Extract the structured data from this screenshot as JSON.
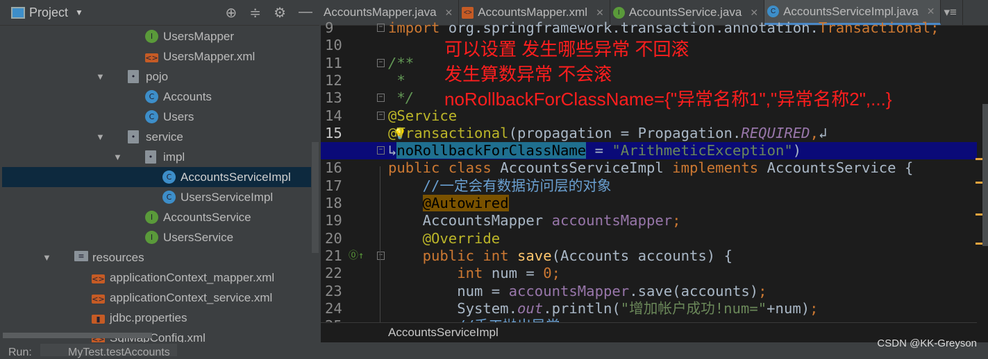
{
  "sidebar": {
    "title": "Project",
    "tree": [
      {
        "label": "UsersMapper",
        "icon": "interface",
        "depth": 4
      },
      {
        "label": "UsersMapper.xml",
        "icon": "xml",
        "depth": 4
      },
      {
        "label": "pojo",
        "icon": "package",
        "depth": 3,
        "expanded": true
      },
      {
        "label": "Accounts",
        "icon": "class",
        "depth": 4
      },
      {
        "label": "Users",
        "icon": "class",
        "depth": 4
      },
      {
        "label": "service",
        "icon": "package",
        "depth": 3,
        "expanded": true
      },
      {
        "label": "impl",
        "icon": "package",
        "depth": 4,
        "expanded": true
      },
      {
        "label": "AccountsServiceImpl",
        "icon": "class",
        "depth": 5,
        "selected": true
      },
      {
        "label": "UsersServiceImpl",
        "icon": "class",
        "depth": 5
      },
      {
        "label": "AccountsService",
        "icon": "interface",
        "depth": 4
      },
      {
        "label": "UsersService",
        "icon": "interface",
        "depth": 4
      },
      {
        "label": "resources",
        "icon": "resources-folder",
        "depth": 1,
        "expanded": true
      },
      {
        "label": "applicationContext_mapper.xml",
        "icon": "spring-xml",
        "depth": 2
      },
      {
        "label": "applicationContext_service.xml",
        "icon": "spring-xml",
        "depth": 2
      },
      {
        "label": "jdbc.properties",
        "icon": "properties",
        "depth": 2
      },
      {
        "label": "SqlMapConfig.xml",
        "icon": "xml",
        "depth": 2
      }
    ]
  },
  "tabs": [
    {
      "label": "AccountsMapper.java",
      "icon": "",
      "active": false
    },
    {
      "label": "AccountsMapper.xml",
      "icon": "xml",
      "active": false
    },
    {
      "label": "AccountsService.java",
      "icon": "interface",
      "active": false
    },
    {
      "label": "AccountsServiceImpl.java",
      "icon": "class",
      "active": true
    }
  ],
  "code": [
    {
      "n": "9",
      "t": [
        [
          "kw",
          "import "
        ],
        [
          "df",
          "org.springframework.transaction.annotation."
        ],
        [
          "kw",
          "Transactional;"
        ]
      ]
    },
    {
      "n": "10",
      "t": []
    },
    {
      "n": "11",
      "t": [
        [
          "cm",
          "/**"
        ]
      ]
    },
    {
      "n": "12",
      "t": [
        [
          "cm",
          " *"
        ]
      ]
    },
    {
      "n": "13",
      "t": [
        [
          "cm",
          " */"
        ]
      ]
    },
    {
      "n": "14",
      "t": [
        [
          "an",
          "@Service"
        ]
      ]
    },
    {
      "n": "15",
      "cur": true,
      "t": [
        [
          "an",
          "@Transactional"
        ],
        [
          "df",
          "(propagation = Propagation."
        ],
        [
          "it",
          "REQUIRED"
        ],
        [
          "kw",
          ","
        ],
        [
          "df",
          "↲"
        ]
      ]
    },
    {
      "n": "",
      "hl": true,
      "t": [
        [
          "df",
          "↳"
        ],
        [
          "sel",
          "noRollbackForClassName"
        ],
        [
          "df",
          " = "
        ],
        [
          "st",
          "\"ArithmeticException\""
        ],
        [
          "df",
          ")"
        ]
      ]
    },
    {
      "n": "16",
      "t": [
        [
          "kw",
          "public class "
        ],
        [
          "df",
          "AccountsServiceImpl "
        ],
        [
          "kw",
          "implements "
        ],
        [
          "df",
          "AccountsService {"
        ]
      ]
    },
    {
      "n": "17",
      "t": [
        [
          "df",
          "    "
        ],
        [
          "lc",
          "//一定会有数据访问层的对象"
        ]
      ]
    },
    {
      "n": "18",
      "t": [
        [
          "df",
          "    "
        ],
        [
          "mark",
          "@Autowired"
        ]
      ]
    },
    {
      "n": "19",
      "t": [
        [
          "df",
          "    AccountsMapper "
        ],
        [
          "fd",
          "accountsMapper"
        ],
        [
          "kw",
          ";"
        ]
      ]
    },
    {
      "n": "20",
      "t": [
        [
          "df",
          "    "
        ],
        [
          "an",
          "@Override"
        ]
      ]
    },
    {
      "n": "21",
      "t": [
        [
          "df",
          "    "
        ],
        [
          "kw",
          "public int "
        ],
        [
          "mt",
          "save"
        ],
        [
          "df",
          "(Accounts accounts) {"
        ]
      ]
    },
    {
      "n": "22",
      "t": [
        [
          "df",
          "        "
        ],
        [
          "kw",
          "int "
        ],
        [
          "df",
          "num = "
        ],
        [
          "kw",
          "0;"
        ]
      ]
    },
    {
      "n": "23",
      "t": [
        [
          "df",
          "        num = "
        ],
        [
          "fd",
          "accountsMapper"
        ],
        [
          "df",
          ".save(accounts)"
        ],
        [
          "kw",
          ";"
        ]
      ]
    },
    {
      "n": "24",
      "t": [
        [
          "df",
          "        System."
        ],
        [
          "it",
          "out"
        ],
        [
          "df",
          ".println("
        ],
        [
          "st",
          "\"增加帐户成功!num=\""
        ],
        [
          "df",
          "+num)"
        ],
        [
          "kw",
          ";"
        ]
      ]
    },
    {
      "n": "25",
      "t": [
        [
          "df",
          "        "
        ],
        [
          "lc",
          "//手工抛出异常"
        ]
      ]
    }
  ],
  "overlay": [
    "可以设置 发生哪些异常 不回滚",
    "发生算数异常 不会滚",
    "noRollbackForClassName={\"异常名称1\",\"异常名称2\",...}"
  ],
  "breadcrumb": "AccountsServiceImpl",
  "run": {
    "label": "Run:",
    "config": "MyTest.testAccounts"
  },
  "watermark": "CSDN @KK-Greyson"
}
